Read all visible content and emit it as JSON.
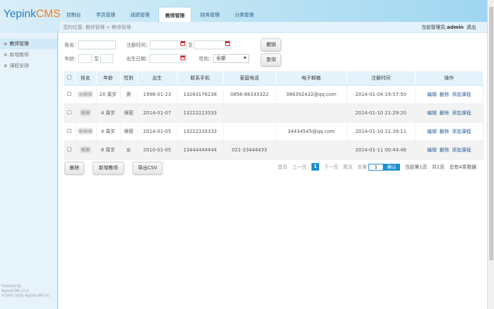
{
  "logo": {
    "part1": "Yepink",
    "part2": "CMS"
  },
  "tabs": [
    "控制台",
    "学员管理",
    "成绩管理",
    "教师管理",
    "财务管理",
    "分类管理"
  ],
  "active_tab": 3,
  "breadcrumb": "您的位置: 教师管理 > 教师管理",
  "admin": {
    "label": "当前管理员:",
    "name": "admin",
    "logout": "退出"
  },
  "sidebar": [
    "教师管理",
    "新增教师",
    "课程安排"
  ],
  "footer": {
    "line1": "Powered By",
    "line2": "YepinkCMS v1.0",
    "line3": "©2007-2016 YepinkCMS Inc."
  },
  "filters": {
    "name_label": "姓名：",
    "reg_label": "注册时间：",
    "to": "至",
    "age_label": "年龄：",
    "birth_label": "出生日期：",
    "gender_label": "性别：",
    "gender_value": "全部",
    "reset": "撤销",
    "search": "查询"
  },
  "table": {
    "headers": [
      "姓名",
      "年龄",
      "性别",
      "出生",
      "联系手机",
      "家庭电话",
      "电子邮箱",
      "注册时间",
      "操作"
    ],
    "rows": [
      {
        "name": "张某某",
        "age": "20 周岁",
        "gender": "男",
        "birth": "1998-01-23",
        "phone": "13263176238",
        "home": "0856-88333322",
        "email": "386392432@qq.com",
        "reg": "2014-01-04 19:57:50"
      },
      {
        "name": "某某",
        "age": "4 周岁",
        "gender": "保密",
        "birth": "2014-01-07",
        "phone": "13222223333",
        "home": "",
        "email": "",
        "reg": "2014-01-10 21:29:20"
      },
      {
        "name": "某某某",
        "age": "4 周岁",
        "gender": "保密",
        "birth": "2014-01-05",
        "phone": "13222333333",
        "home": "",
        "email": "34434545@qq.com",
        "reg": "2014-01-10 21:39:11"
      },
      {
        "name": "某某",
        "age": "8 周岁",
        "gender": "女",
        "birth": "2010-01-05",
        "phone": "13444444444",
        "home": "021-33444433",
        "email": "",
        "reg": "2014-01-11 00:44:48"
      }
    ],
    "ops": [
      "编辑",
      "删除",
      "添加课程"
    ]
  },
  "actions": {
    "delete": "删除",
    "add": "新增教师",
    "export": "导出CSV"
  },
  "pager": {
    "first": "首页",
    "prev": "上一页",
    "current": "1",
    "next": "下一页",
    "last": "尾页",
    "goto": "去第",
    "goto_value": "1",
    "confirm": "确认",
    "page_info": "当前第1页",
    "total_pages": "共1页",
    "total": "总有4条数据"
  }
}
